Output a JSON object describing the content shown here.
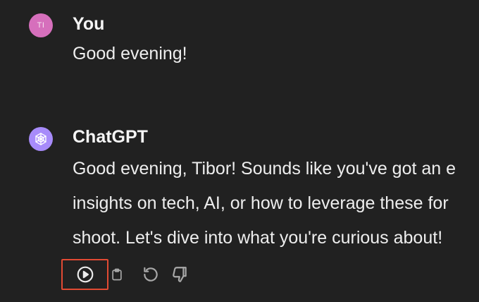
{
  "user_message": {
    "avatar_initials": "TI",
    "author": "You",
    "text": "Good evening!"
  },
  "bot_message": {
    "author": "ChatGPT",
    "avatar_icon": "openai-logo-icon",
    "lines": [
      "Good evening, Tibor! Sounds like you've got an e",
      "insights on tech, AI, or how to leverage these for",
      "shoot. Let's dive into what you're curious about!"
    ]
  },
  "actions": [
    {
      "name": "read-aloud",
      "icon": "play-circle-icon"
    },
    {
      "name": "copy",
      "icon": "clipboard-icon"
    },
    {
      "name": "regenerate",
      "icon": "refresh-icon"
    },
    {
      "name": "bad-response",
      "icon": "thumbs-down-icon"
    }
  ],
  "colors": {
    "background": "#212121",
    "user_avatar": "#d66fbc",
    "bot_avatar": "#a78bfa",
    "highlight": "#e24a33",
    "icon": "#a8a8a8"
  }
}
